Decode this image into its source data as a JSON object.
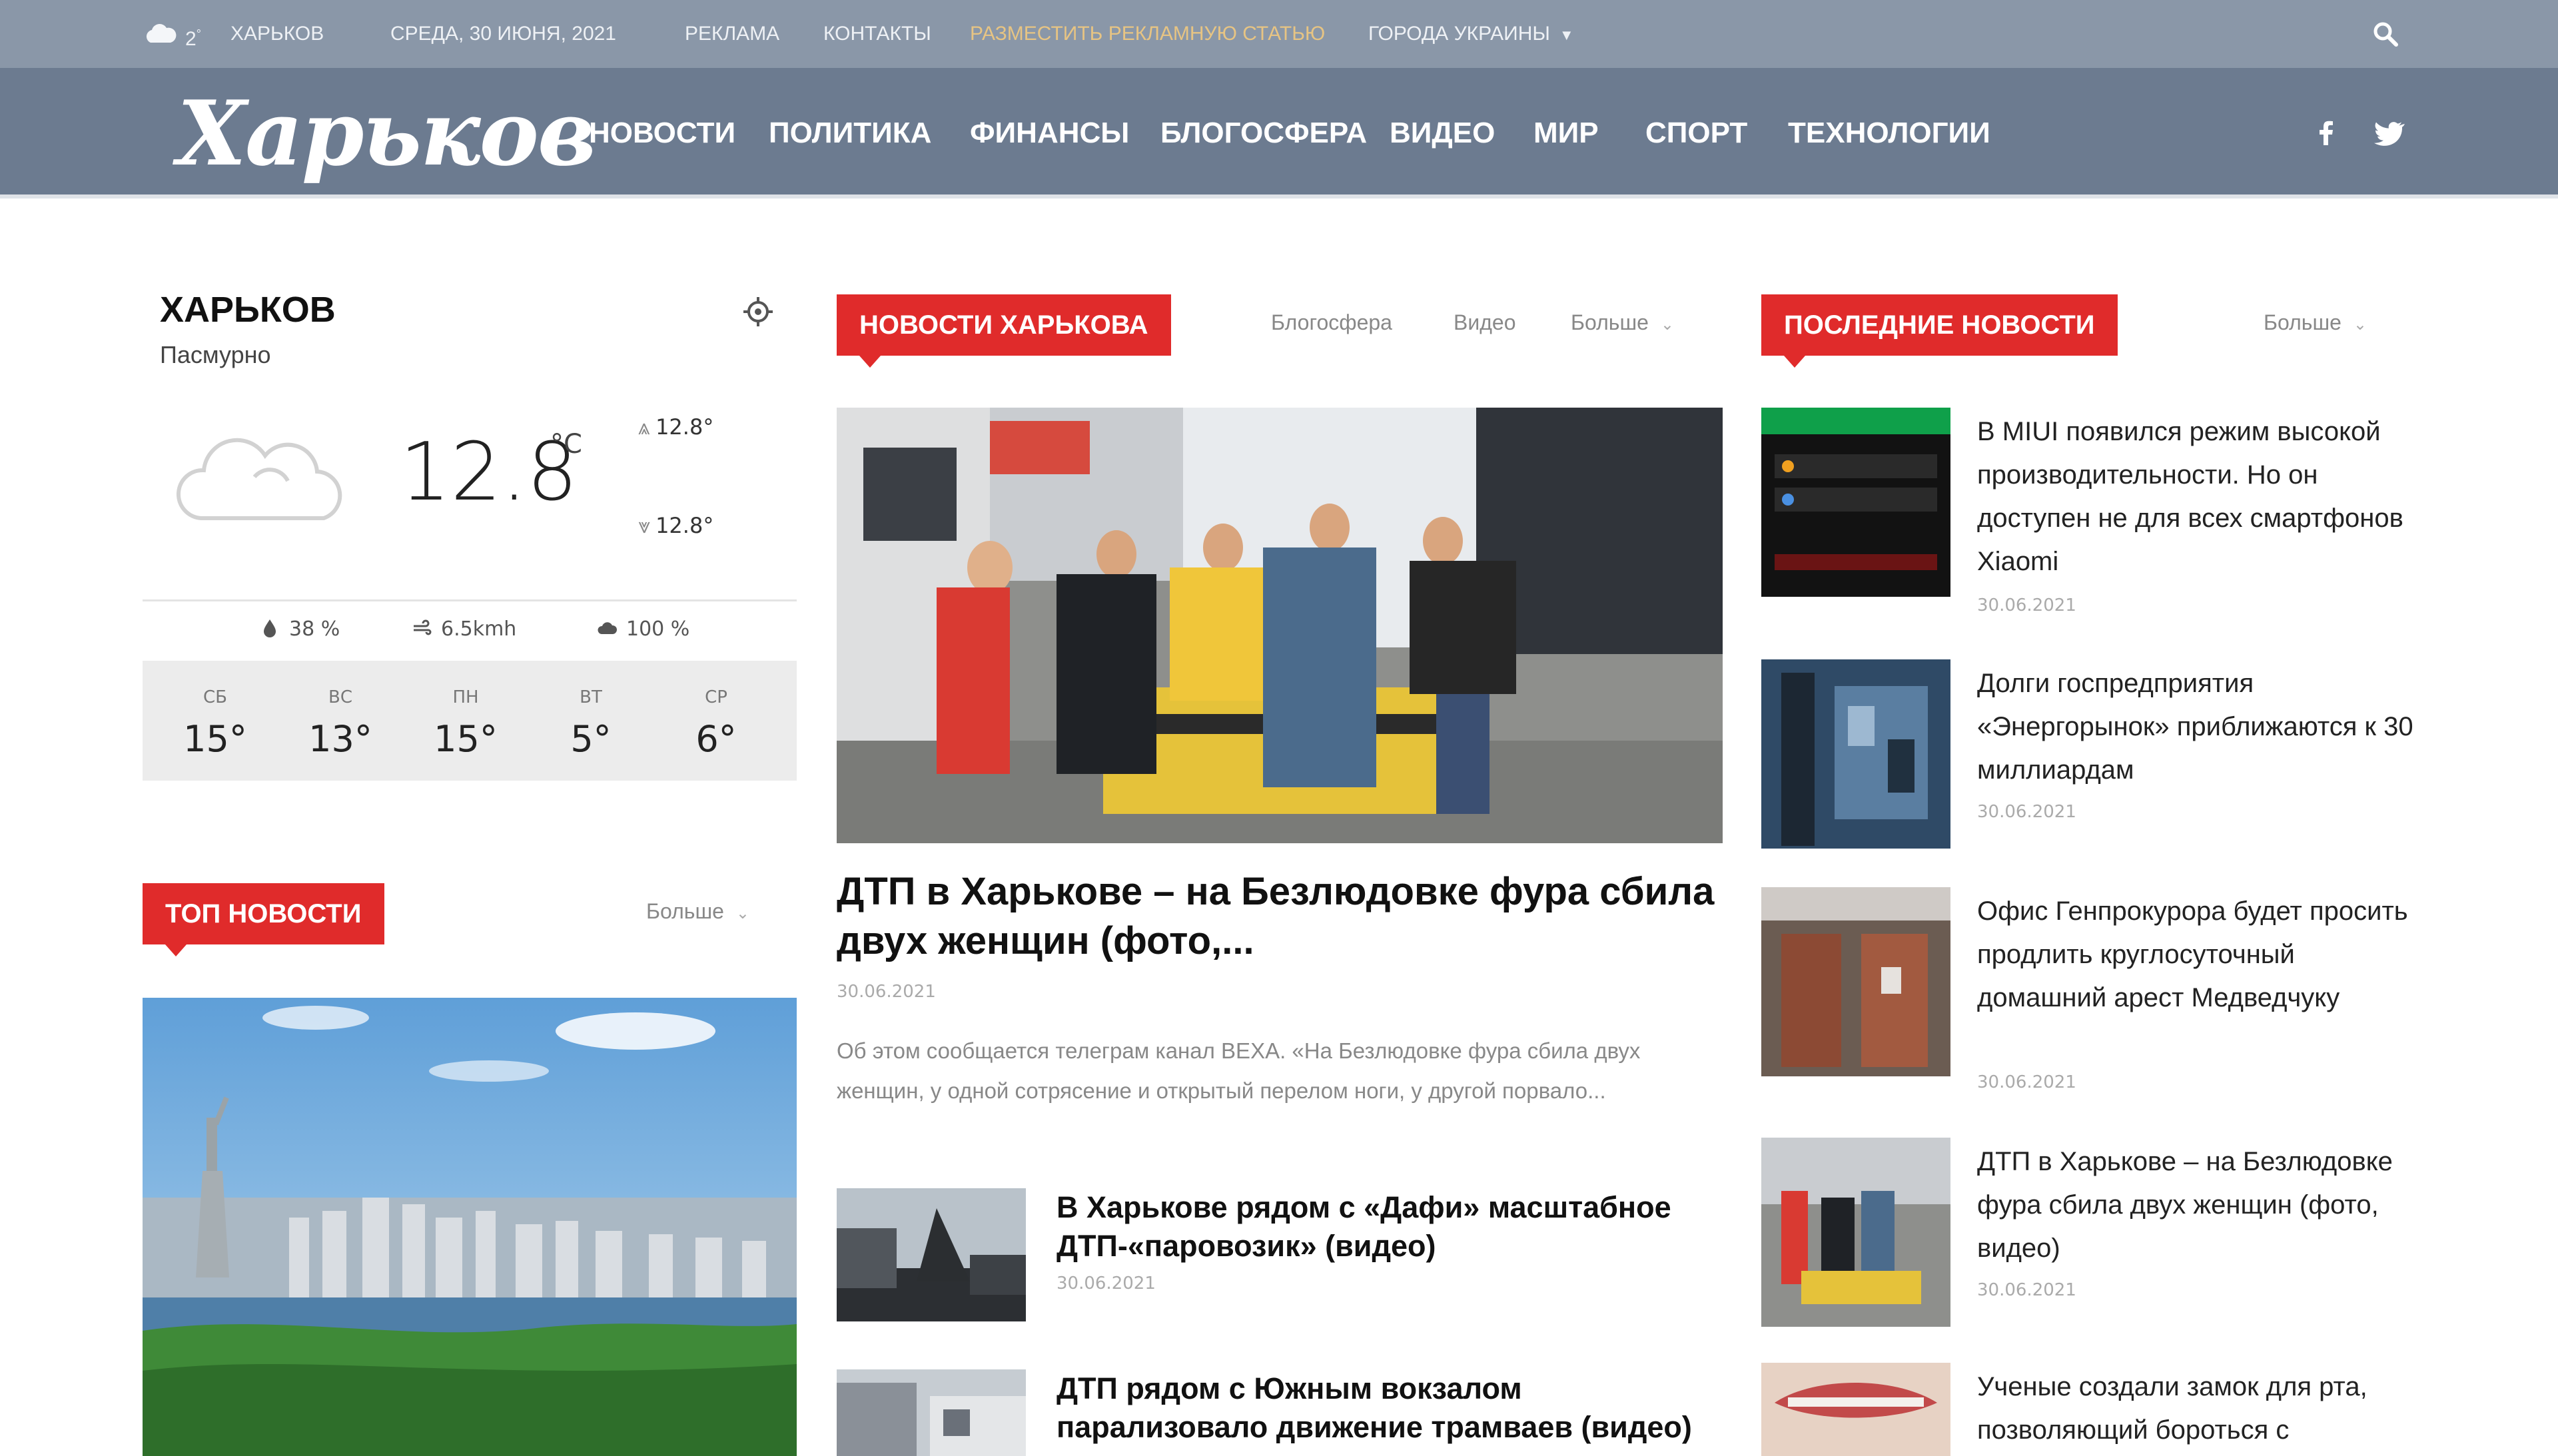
{
  "topbar": {
    "temp": "2",
    "temp_unit": "°",
    "city": "ХАРЬКОВ",
    "date": "СРЕДА, 30 ИЮНЯ, 2021",
    "links": [
      "РЕКЛАМА",
      "КОНТАКТЫ"
    ],
    "place_article": "РАЗМЕСТИТЬ РЕКЛАМНУЮ СТАТЬЮ",
    "cities_label": "ГОРОДА УКРАИНЫ",
    "icons": [
      "cloud-icon",
      "chevron-down-icon",
      "search-icon"
    ]
  },
  "nav": {
    "logo": "Харьков",
    "items": [
      "НОВОСТИ",
      "ПОЛИТИКА",
      "ФИНАНСЫ",
      "БЛОГОСФЕРА",
      "ВИДЕО",
      "МИР",
      "СПОРТ",
      "ТЕХНОЛОГИИ"
    ],
    "social_icons": [
      "facebook-icon",
      "twitter-icon"
    ]
  },
  "weather": {
    "city": "ХАРЬКОВ",
    "description": "Пасмурно",
    "temp": "12.8",
    "unit": "°C",
    "high": "12.8°",
    "low": "12.8°",
    "humidity": "38 %",
    "wind": "6.5kmh",
    "clouds": "100 %",
    "forecast": [
      {
        "day": "СБ",
        "temp": "15°"
      },
      {
        "day": "ВС",
        "temp": "13°"
      },
      {
        "day": "ПН",
        "temp": "15°"
      },
      {
        "day": "ВТ",
        "temp": "5°"
      },
      {
        "day": "СР",
        "temp": "6°"
      }
    ]
  },
  "top_news": {
    "header": "ТОП НОВОСТИ",
    "more": "Больше"
  },
  "center": {
    "header": "НОВОСТИ ХАРЬКОВА",
    "tabs": [
      "Блогосфера",
      "Видео"
    ],
    "more": "Больше",
    "main": {
      "title": "ДТП в Харькове – на Безлюдовке фура сбила двух женщин (фото,...",
      "date": "30.06.2021",
      "excerpt": "Об этом сообщается телеграм канал ВЕХА. «На Безлюдовке фура сбила двух женщин, у одной сотрясение и открытый перелом ноги, у другой порвало..."
    },
    "items": [
      {
        "title": "В Харькове рядом с «Дафи» масштабное ДТП-«паровозик» (видео)",
        "date": "30.06.2021"
      },
      {
        "title": "ДТП рядом с Южным вокзалом парализовало движение трамваев (видео)",
        "date": ""
      }
    ]
  },
  "latest": {
    "header": "ПОСЛЕДНИЕ НОВОСТИ",
    "more": "Больше",
    "items": [
      {
        "title": "В MIUI появился режим высокой производительности. Но он доступен не для всех смартфонов Xiaomi",
        "date": "30.06.2021"
      },
      {
        "title": "Долги госпредприятия «Энергорынок» приближаются к 30 миллиардам",
        "date": "30.06.2021"
      },
      {
        "title": "Офис Генпрокурора будет просить продлить круглосуточный домашний арест Медведчуку",
        "date": "30.06.2021"
      },
      {
        "title": "ДТП в Харькове – на Безлюдовке фура сбила двух женщин (фото, видео)",
        "date": "30.06.2021"
      },
      {
        "title": "Ученые создали замок для рта, позволяющий бороться с",
        "date": ""
      }
    ]
  }
}
